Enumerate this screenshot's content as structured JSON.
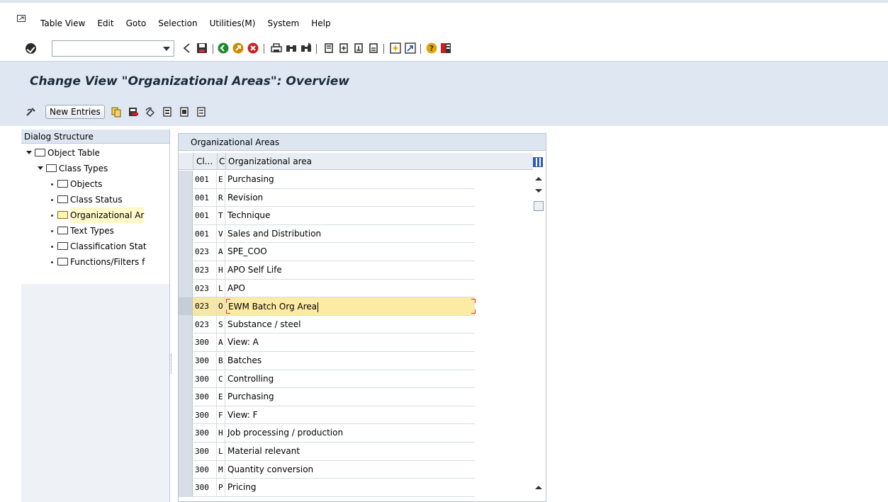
{
  "menu": {
    "items": [
      "Table View",
      "Edit",
      "Goto",
      "Selection",
      "Utilities(M)",
      "System",
      "Help"
    ]
  },
  "toolbar": {
    "command_value": "",
    "icons": [
      "enter-icon",
      "back-icon",
      "save-icon",
      "back-nav-icon",
      "exit-icon",
      "cancel-icon",
      "print-icon",
      "find-icon",
      "find-next-icon",
      "first-page-icon",
      "prev-page-icon",
      "next-page-icon",
      "last-page-icon",
      "new-session-icon",
      "shortcut-icon",
      "help-icon",
      "layout-icon"
    ]
  },
  "title": "Change View \"Organizational Areas\": Overview",
  "app_toolbar": {
    "new_entries_label": "New Entries"
  },
  "dialog_structure": {
    "header": "Dialog Structure",
    "nodes": [
      {
        "label": "Object Table",
        "level": 0,
        "expanded": true
      },
      {
        "label": "Class Types",
        "level": 1,
        "expanded": true
      },
      {
        "label": "Objects",
        "level": 2
      },
      {
        "label": "Class Status",
        "level": 2
      },
      {
        "label": "Organizational Ar",
        "level": 2,
        "selected": true
      },
      {
        "label": "Text Types",
        "level": 2
      },
      {
        "label": "Classification Stat",
        "level": 2
      },
      {
        "label": "Functions/Filters f",
        "level": 2
      }
    ]
  },
  "table": {
    "caption": "Organizational Areas",
    "headers": {
      "class_type": "Cl...",
      "code": "C",
      "area": "Organizational area"
    },
    "rows": [
      {
        "class_type": "001",
        "code": "E",
        "area": "Purchasing"
      },
      {
        "class_type": "001",
        "code": "R",
        "area": "Revision"
      },
      {
        "class_type": "001",
        "code": "T",
        "area": "Technique"
      },
      {
        "class_type": "001",
        "code": "V",
        "area": "Sales and Distribution"
      },
      {
        "class_type": "023",
        "code": "A",
        "area": "SPE_COO"
      },
      {
        "class_type": "023",
        "code": "H",
        "area": "APO Self Life"
      },
      {
        "class_type": "023",
        "code": "L",
        "area": "APO"
      },
      {
        "class_type": "023",
        "code": "O",
        "area": "EWM Batch Org Area",
        "focus": true
      },
      {
        "class_type": "023",
        "code": "S",
        "area": "Substance / steel"
      },
      {
        "class_type": "300",
        "code": "A",
        "area": "View: A"
      },
      {
        "class_type": "300",
        "code": "B",
        "area": "Batches"
      },
      {
        "class_type": "300",
        "code": "C",
        "area": "Controlling"
      },
      {
        "class_type": "300",
        "code": "E",
        "area": "Purchasing"
      },
      {
        "class_type": "300",
        "code": "F",
        "area": "View: F"
      },
      {
        "class_type": "300",
        "code": "H",
        "area": "Job processing / production"
      },
      {
        "class_type": "300",
        "code": "L",
        "area": "Material relevant"
      },
      {
        "class_type": "300",
        "code": "M",
        "area": "Quantity conversion"
      },
      {
        "class_type": "300",
        "code": "P",
        "area": "Pricing"
      }
    ]
  },
  "colors": {
    "title_band": "#dfe8f2",
    "focus_row": "#fdeaa3",
    "selected_node": "#fff8c8"
  }
}
